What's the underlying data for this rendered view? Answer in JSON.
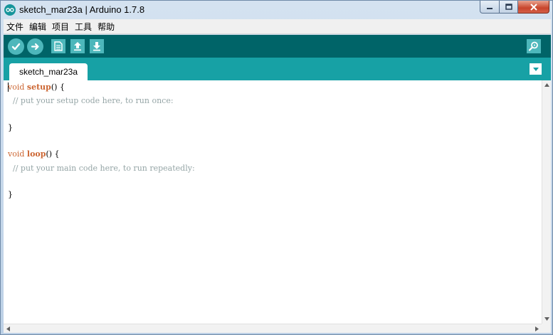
{
  "window": {
    "title": "sketch_mar23a | Arduino 1.7.8",
    "icon": "arduino-logo-icon"
  },
  "menu": {
    "items": [
      "文件",
      "编辑",
      "项目",
      "工具",
      "帮助"
    ]
  },
  "toolbar": {
    "icons": [
      "verify-icon",
      "upload-icon",
      "new-icon",
      "open-icon",
      "save-icon",
      "serial-monitor-icon"
    ]
  },
  "tabs": [
    {
      "label": "sketch_mar23a"
    }
  ],
  "editor": {
    "lines": [
      {
        "type": "void",
        "fn": "setup",
        "rest": "() {"
      },
      {
        "comment": "  // put your setup code here, to run once:"
      },
      {
        "plain": ""
      },
      {
        "plain": "}"
      },
      {
        "plain": ""
      },
      {
        "type": "void",
        "fn": "loop",
        "rest": "() {"
      },
      {
        "comment": "  // put your main code here, to run repeatedly:"
      },
      {
        "plain": ""
      },
      {
        "plain": "}"
      }
    ]
  },
  "colors": {
    "toolbar": "#006468",
    "tabstrip": "#17a1a5",
    "button": "#4db7bb",
    "keyword": "#cc6633",
    "comment": "#95a5a6"
  }
}
